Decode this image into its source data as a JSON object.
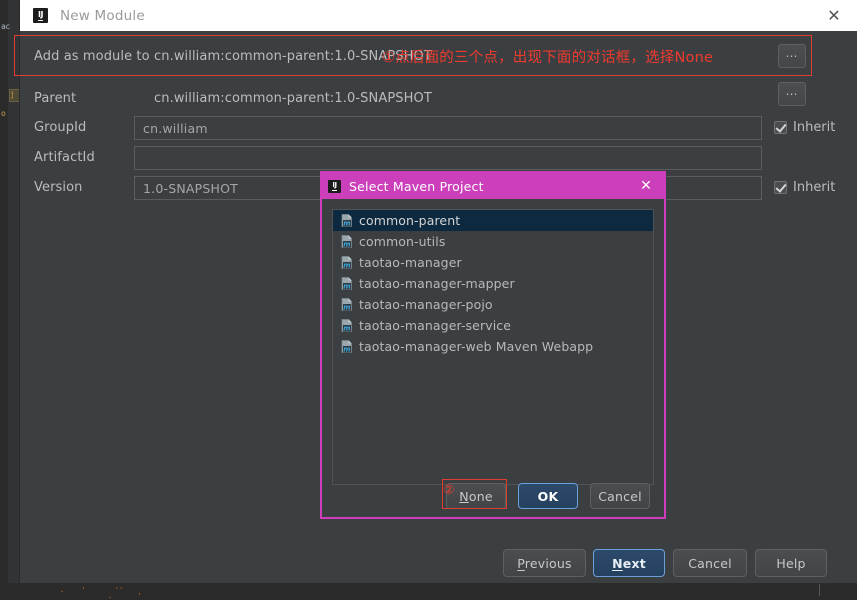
{
  "ide": {
    "left_tab_labels": [
      "ac",
      "j",
      "o"
    ]
  },
  "window": {
    "title": "New Module",
    "icon": "intellij-idea-icon",
    "close_icon": "close-icon"
  },
  "form": {
    "rows": [
      {
        "label": "Add as module to",
        "value": "cn.william:common-parent:1.0-SNAPSHOT"
      },
      {
        "label": "Parent",
        "value": "cn.william:common-parent:1.0-SNAPSHOT"
      }
    ],
    "group_id": {
      "label": "GroupId",
      "value": "cn.william",
      "inherit_label": "Inherit",
      "inherit_checked": true
    },
    "artifact_id": {
      "label": "ArtifactId",
      "value": "",
      "placeholder": ""
    },
    "version": {
      "label": "Version",
      "value": "1.0-SNAPSHOT",
      "inherit_label": "Inherit",
      "inherit_checked": true
    },
    "browse_button_label": "...",
    "browse_icon": "ellipsis-icon"
  },
  "annotations": {
    "step1_text": "①点后面的三个点，出现下面的对话框，选择None",
    "step2_marker": "②",
    "color": "#f03a2e"
  },
  "footer": {
    "previous": "Previous",
    "next": "Next",
    "cancel": "Cancel",
    "help": "Help"
  },
  "maven_dialog": {
    "title": "Select Maven Project",
    "icon": "intellij-idea-icon",
    "close_icon": "close-icon",
    "accent_color": "#cc3fbb",
    "selection_color": "#0d293f",
    "items": [
      {
        "label": "common-parent",
        "icon": "maven-module-icon",
        "selected": true
      },
      {
        "label": "common-utils",
        "icon": "maven-module-icon",
        "selected": false
      },
      {
        "label": "taotao-manager",
        "icon": "maven-module-icon",
        "selected": false
      },
      {
        "label": "taotao-manager-mapper",
        "icon": "maven-module-icon",
        "selected": false
      },
      {
        "label": "taotao-manager-pojo",
        "icon": "maven-module-icon",
        "selected": false
      },
      {
        "label": "taotao-manager-service",
        "icon": "maven-module-icon",
        "selected": false
      },
      {
        "label": "taotao-manager-web Maven Webapp",
        "icon": "maven-module-icon",
        "selected": false
      }
    ],
    "buttons": {
      "none": "None",
      "ok": "OK",
      "cancel": "Cancel"
    }
  }
}
